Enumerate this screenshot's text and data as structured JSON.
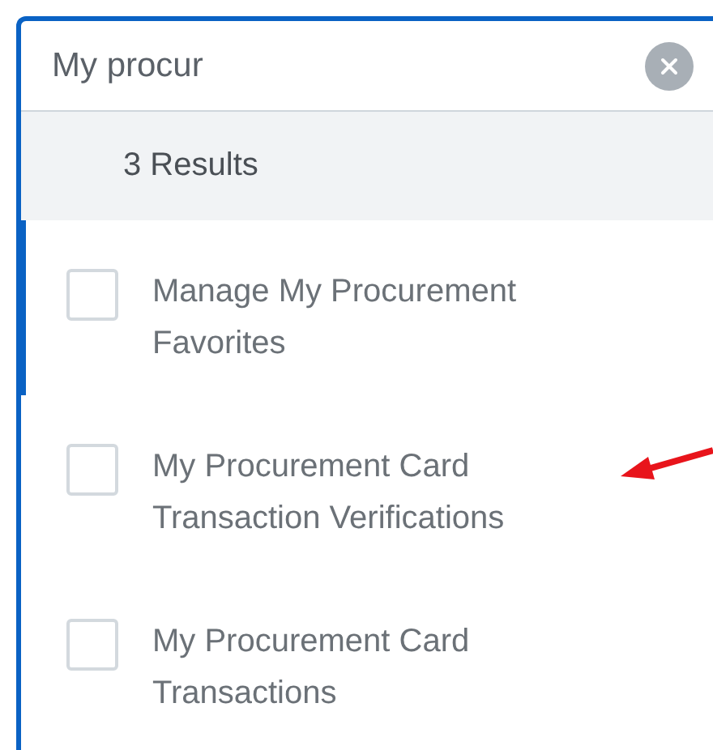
{
  "search": {
    "value": "My procur"
  },
  "results_count": "3 Results",
  "results": [
    {
      "label": "Manage My Procurement Favorites",
      "selected": true,
      "checked": false
    },
    {
      "label": "My Procurement Card Transaction Verifications",
      "selected": false,
      "checked": false
    },
    {
      "label": "My Procurement Card Transactions",
      "selected": false,
      "checked": false
    }
  ]
}
